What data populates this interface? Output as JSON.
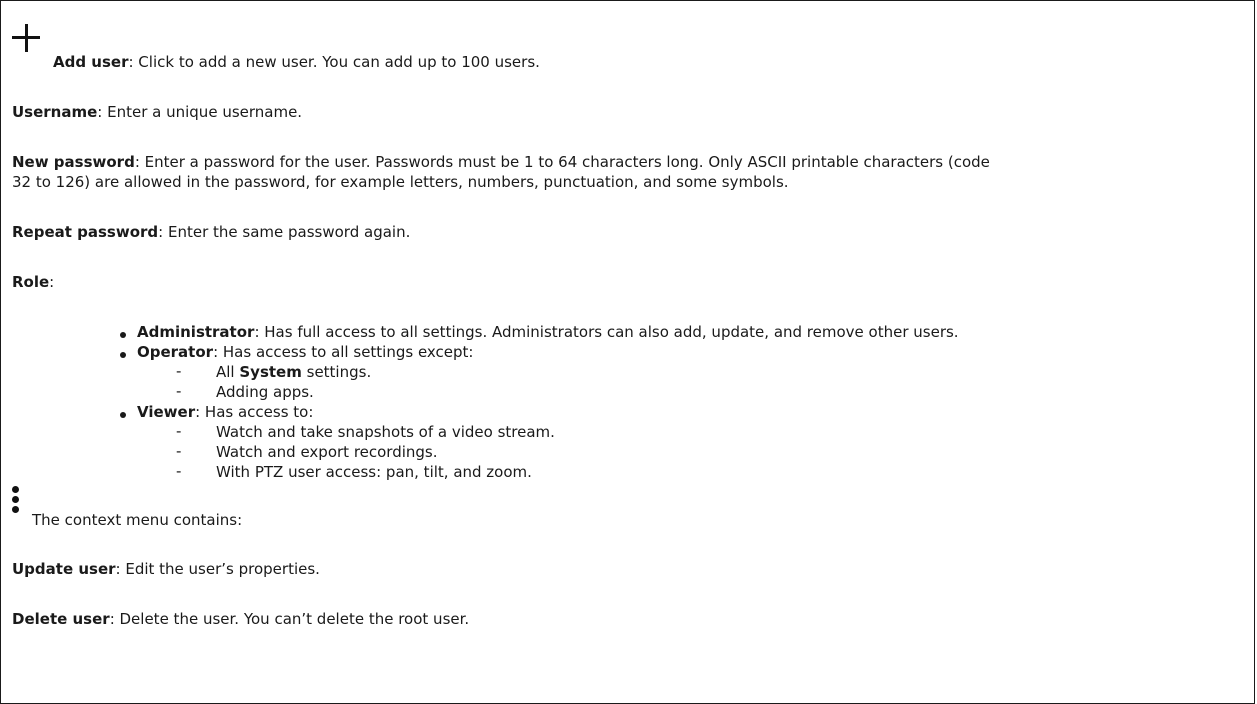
{
  "add_user": {
    "label": "Add user",
    "text": ": Click to add a new user. You can add up to 100 users."
  },
  "username": {
    "label": "Username",
    "text": ": Enter a unique username."
  },
  "new_password": {
    "label": "New password",
    "text_line1": ": Enter a password for the user. Passwords must be 1 to 64 characters long. Only ASCII printable characters (code",
    "text_line2": "32 to 126) are allowed in the password, for example letters, numbers, punctuation, and some symbols."
  },
  "repeat_password": {
    "label": "Repeat password",
    "text": ": Enter the same password again."
  },
  "role": {
    "label": "Role",
    "colon": ":",
    "administrator": {
      "label": "Administrator",
      "text": ": Has full access to all settings. Administrators can also add, update, and remove other users."
    },
    "operator": {
      "label": "Operator",
      "text": ": Has access to all settings except:",
      "items": [
        {
          "prefix": "All ",
          "bold": "System",
          "suffix": " settings."
        },
        {
          "prefix": "Adding apps.",
          "bold": "",
          "suffix": ""
        }
      ]
    },
    "viewer": {
      "label": "Viewer",
      "text": ": Has access to:",
      "items": [
        "Watch and take snapshots of a video stream.",
        "Watch and export recordings.",
        "With PTZ user access: pan, tilt, and zoom."
      ]
    }
  },
  "context_menu": {
    "text": "The context menu contains:"
  },
  "update_user": {
    "label": "Update user",
    "text": ": Edit the user’s properties."
  },
  "delete_user": {
    "label": "Delete user",
    "text": ": Delete the user. You can’t delete the root user."
  },
  "icons": {
    "add": "plus-icon",
    "context_menu": "kebab-menu-icon"
  }
}
